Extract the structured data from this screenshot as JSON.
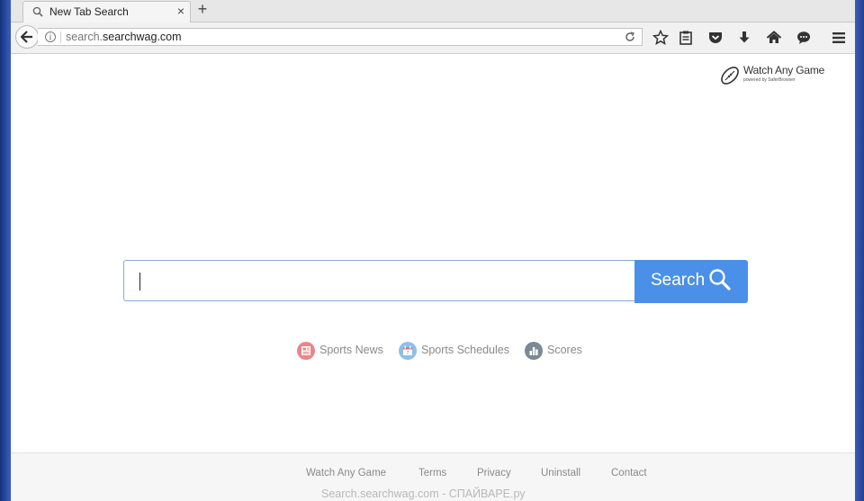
{
  "browser": {
    "tab_title": "New Tab Search",
    "tab_close": "×",
    "new_tab": "+",
    "url_sub": "search.",
    "url_domain": "searchwag.com",
    "info_glyph": "i"
  },
  "page": {
    "logo_title": "Watch Any Game",
    "logo_sub": "powered by SaferBrowser",
    "search_button_label": "Search",
    "search_value": "",
    "links": [
      {
        "label": "Sports News",
        "icon": "newspaper-icon",
        "color": "#e8868a"
      },
      {
        "label": "Sports Schedules",
        "icon": "calendar-icon",
        "color": "#8cc0e6"
      },
      {
        "label": "Scores",
        "icon": "bar-chart-icon",
        "color": "#7c8894"
      }
    ]
  },
  "footer": {
    "links": [
      "Watch Any Game",
      "Terms",
      "Privacy",
      "Uninstall",
      "Contact"
    ],
    "watermark": "Search.searchwag.com - СПАЙВАРЕ.ру"
  },
  "colors": {
    "accent": "#4a90e8",
    "desktop": "#1f3f8f"
  }
}
